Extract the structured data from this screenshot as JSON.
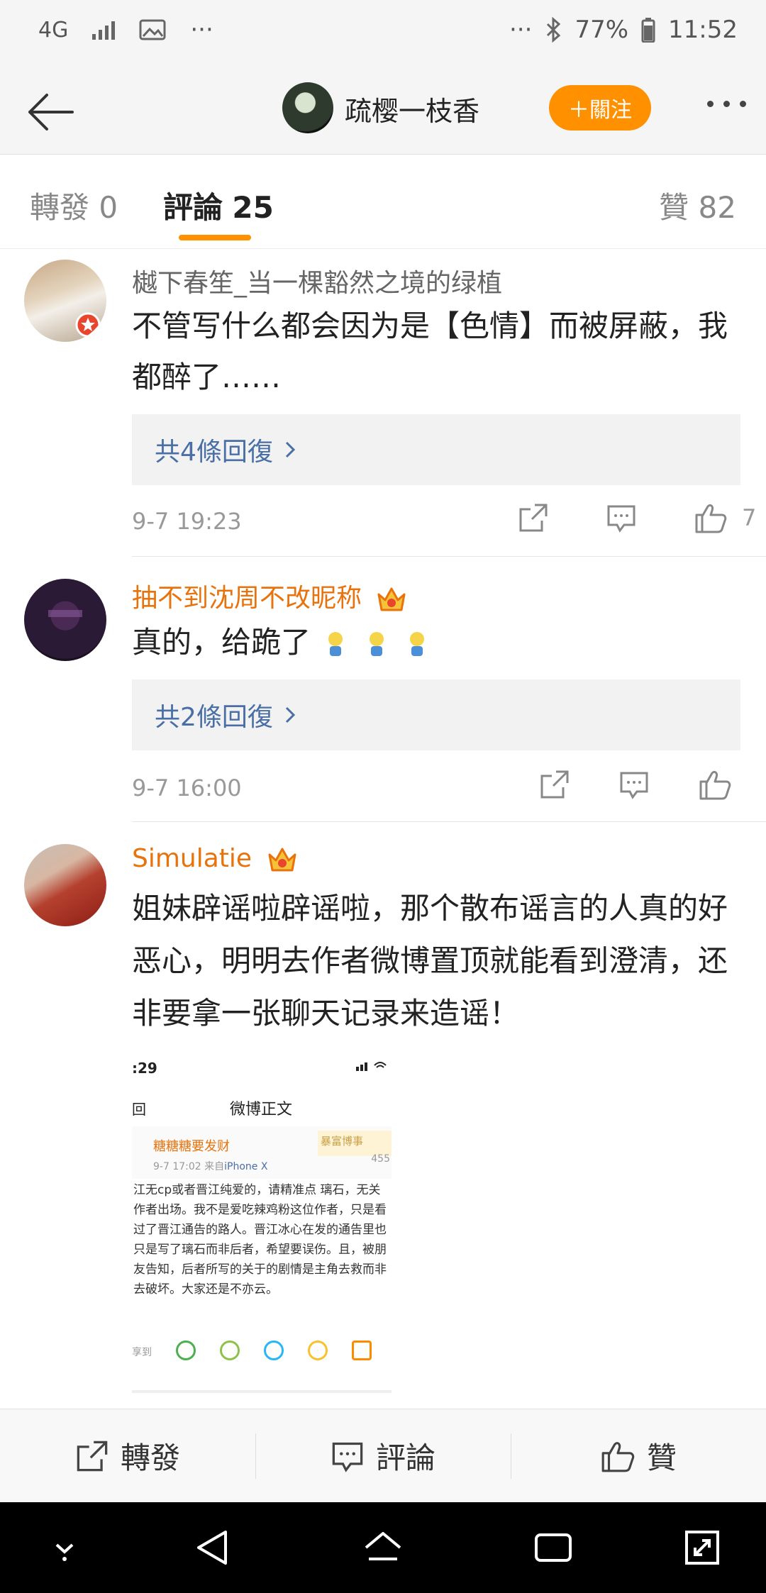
{
  "status_bar": {
    "network": "4G",
    "dots_left": "···",
    "dots_right": "···",
    "battery": "77%",
    "time": "11:52"
  },
  "header": {
    "username": "疏樱一枝香",
    "follow_label": "＋關注"
  },
  "tabs": {
    "repost_label": "轉發",
    "repost_count": "0",
    "comment_label": "評論",
    "comment_count": "25",
    "like_label": "贊",
    "like_count": "82"
  },
  "comments": [
    {
      "username": "樾下春笙_当一棵豁然之境的绿植",
      "text": "不管写什么都会因为是【色情】而被屏蔽，我都醉了……",
      "replies_label": "共4條回復",
      "time": "9-7 19:23",
      "likes": "7"
    },
    {
      "username": "抽不到沈周不改昵称",
      "text": "真的，给跪了",
      "replies_label": "共2條回復",
      "time": "9-7 16:00",
      "likes": ""
    },
    {
      "username": "Simulatie",
      "text": "姐妹辟谣啦辟谣啦，那个散布谣言的人真的好恶心，明明去作者微博置顶就能看到澄清，还非要拿一张聊天记录来造谣！"
    }
  ],
  "screenshot": {
    "time": ":29",
    "title": "微博正文",
    "back": "回",
    "name": "糖糖糖要发财",
    "sub_time": "9-7 17:02",
    "sub_from": "来自",
    "sub_device": "iPhone X",
    "card": "暴富博事",
    "num": "455",
    "body": "江无cp或者晋江纯爱的，请精准点 璃石，无关作者出场。我不是爱吃辣鸡粉这位作者，只是看过了晋江通告的路人。晋江冰心在发的通告里也只是写了璃石而非后者，希望要误伤。且，被朋友告知，后者所写的关于的剧情是主角去救而非去破坏。大家还是不亦云。",
    "share": "享到"
  },
  "toolbar": {
    "repost": "轉發",
    "comment": "評論",
    "like": "贊"
  }
}
